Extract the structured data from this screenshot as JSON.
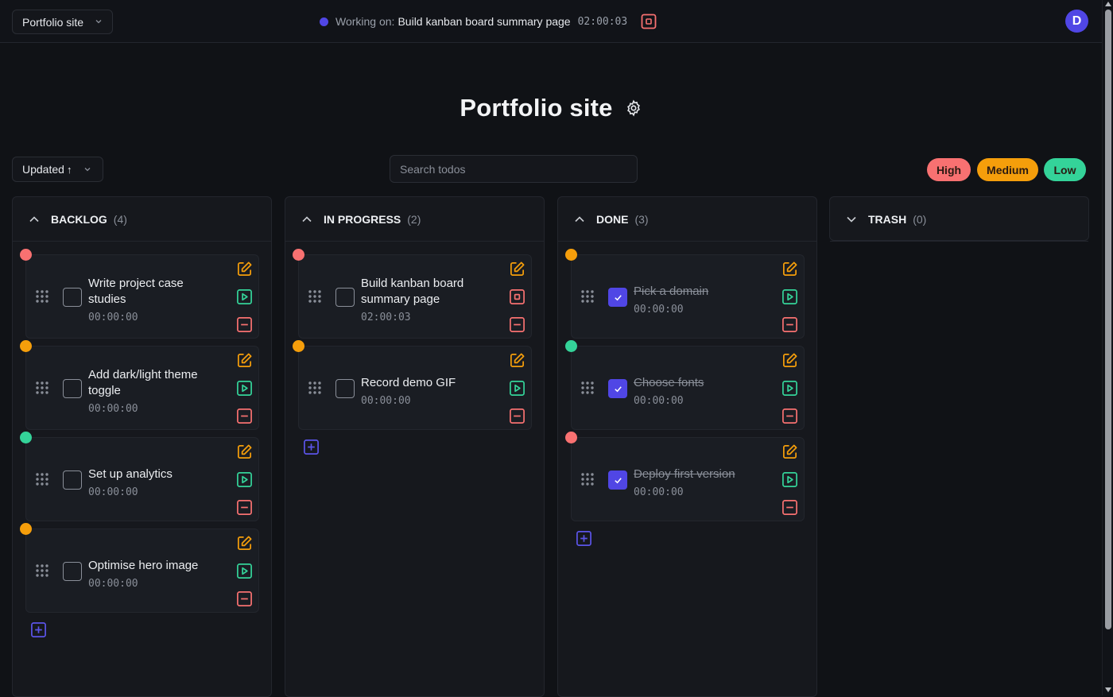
{
  "topbar": {
    "project": "Portfolio site",
    "working_prefix": "Working on:",
    "working_task": "Build kanban board summary page",
    "working_timer": "02:00:03",
    "avatar_initial": "D"
  },
  "page": {
    "title": "Portfolio site"
  },
  "toolbar": {
    "sort_label": "Updated",
    "sort_arrow": "↑",
    "search_placeholder": "Search todos",
    "search_value": "",
    "priority_filters": [
      "High",
      "Medium",
      "Low"
    ]
  },
  "colors": {
    "high": "#f87171",
    "medium": "#f59e0b",
    "low": "#34d399",
    "accent": "#5046e5"
  },
  "columns": [
    {
      "name": "BACKLOG",
      "count": "(4)",
      "expanded": true,
      "cards": [
        {
          "title": "Write project case studies",
          "time": "00:00:00",
          "priority": "high",
          "done": false,
          "running": false
        },
        {
          "title": "Add dark/light theme toggle",
          "time": "00:00:00",
          "priority": "medium",
          "done": false,
          "running": false
        },
        {
          "title": "Set up analytics",
          "time": "00:00:00",
          "priority": "low",
          "done": false,
          "running": false
        },
        {
          "title": "Optimise hero image",
          "time": "00:00:00",
          "priority": "medium",
          "done": false,
          "running": false
        }
      ]
    },
    {
      "name": "IN PROGRESS",
      "count": "(2)",
      "expanded": true,
      "cards": [
        {
          "title": "Build kanban board summary page",
          "time": "02:00:03",
          "priority": "high",
          "done": false,
          "running": true
        },
        {
          "title": "Record demo GIF",
          "time": "00:00:00",
          "priority": "medium",
          "done": false,
          "running": false
        }
      ]
    },
    {
      "name": "DONE",
      "count": "(3)",
      "expanded": true,
      "cards": [
        {
          "title": "Pick a domain",
          "time": "00:00:00",
          "priority": "medium",
          "done": true,
          "running": false
        },
        {
          "title": "Choose fonts",
          "time": "00:00:00",
          "priority": "low",
          "done": true,
          "running": false
        },
        {
          "title": "Deploy first version",
          "time": "00:00:00",
          "priority": "high",
          "done": true,
          "running": false
        }
      ]
    },
    {
      "name": "TRASH",
      "count": "(0)",
      "expanded": false,
      "cards": []
    }
  ]
}
